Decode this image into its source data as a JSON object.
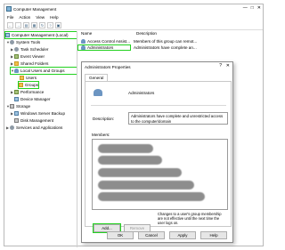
{
  "window": {
    "title": "Computer Management",
    "controls": [
      "—",
      "□",
      "✕"
    ]
  },
  "menu": [
    "File",
    "Action",
    "View",
    "Help"
  ],
  "toolbar": [
    "←",
    "→",
    "▤",
    "▦",
    "↻",
    "?",
    "▣"
  ],
  "tree": {
    "root": "Computer Management (Local)",
    "items": [
      {
        "label": "System Tools",
        "icon": "gear-icon"
      },
      {
        "label": "Task Scheduler",
        "icon": "clock-icon"
      },
      {
        "label": "Event Viewer",
        "icon": "event-icon"
      },
      {
        "label": "Shared Folders",
        "icon": "folder-icon"
      },
      {
        "label": "Local Users and Groups",
        "icon": "users-icon"
      },
      {
        "label": "Users",
        "icon": "folder-icon"
      },
      {
        "label": "Groups",
        "icon": "folder-icon"
      },
      {
        "label": "Performance",
        "icon": "performance-icon"
      },
      {
        "label": "Device Manager",
        "icon": "device-icon"
      },
      {
        "label": "Storage",
        "icon": "storage-icon"
      },
      {
        "label": "Windows Server Backup",
        "icon": "backup-icon"
      },
      {
        "label": "Disk Management",
        "icon": "disk-icon"
      },
      {
        "label": "Services and Applications",
        "icon": "services-icon"
      }
    ]
  },
  "list": {
    "columns": [
      "Name",
      "Description"
    ],
    "rows": [
      {
        "name": "Access Control Assist...",
        "desc": "Members of this group can remot..."
      },
      {
        "name": "Administrators",
        "desc": "Administrators have complete an..."
      }
    ]
  },
  "dialog": {
    "title": "Administrators Properties",
    "help": "?",
    "close": "✕",
    "tab": "General",
    "group_name": "Administrators",
    "description_label": "Description:",
    "description_value": "Administrators have complete and unrestricted access to the computer/domain",
    "members_label": "Members:",
    "add_label": "Add...",
    "remove_label": "Remove",
    "note": "Changes to a user's group membership are not effective until the next time the user logs on.",
    "ok_label": "OK",
    "cancel_label": "Cancel",
    "apply_label": "Apply",
    "help_label": "Help"
  },
  "colors": {
    "highlight": "#22d11f",
    "blur": "#8d8d8d"
  }
}
